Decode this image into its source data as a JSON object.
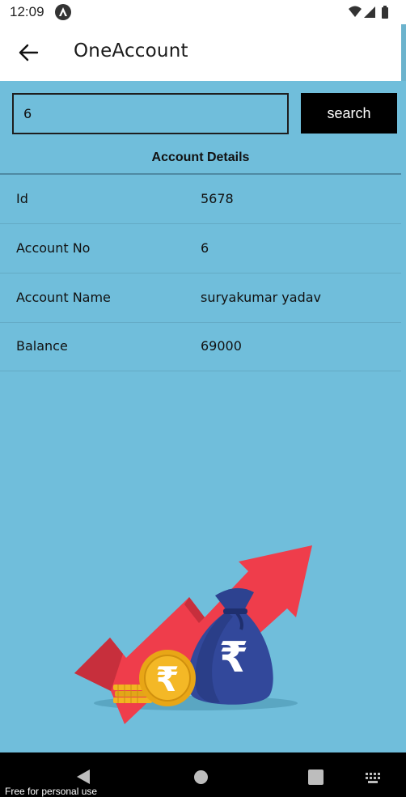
{
  "status_bar": {
    "time": "12:09"
  },
  "app_bar": {
    "title": "OneAccount"
  },
  "search": {
    "value": "6",
    "button_label": "search"
  },
  "details": {
    "title": "Account Details",
    "rows": [
      {
        "label": "Id",
        "value": "5678"
      },
      {
        "label": "Account No",
        "value": "6"
      },
      {
        "label": "Account Name",
        "value": "suryakumar yadav"
      },
      {
        "label": "Balance",
        "value": "69000"
      }
    ]
  },
  "watermark": "Free for personal use",
  "colors": {
    "background": "#70bedb",
    "button": "#000000",
    "arrow": "#ef3d4b",
    "bag": "#2f4597",
    "coin": "#f2b520"
  }
}
